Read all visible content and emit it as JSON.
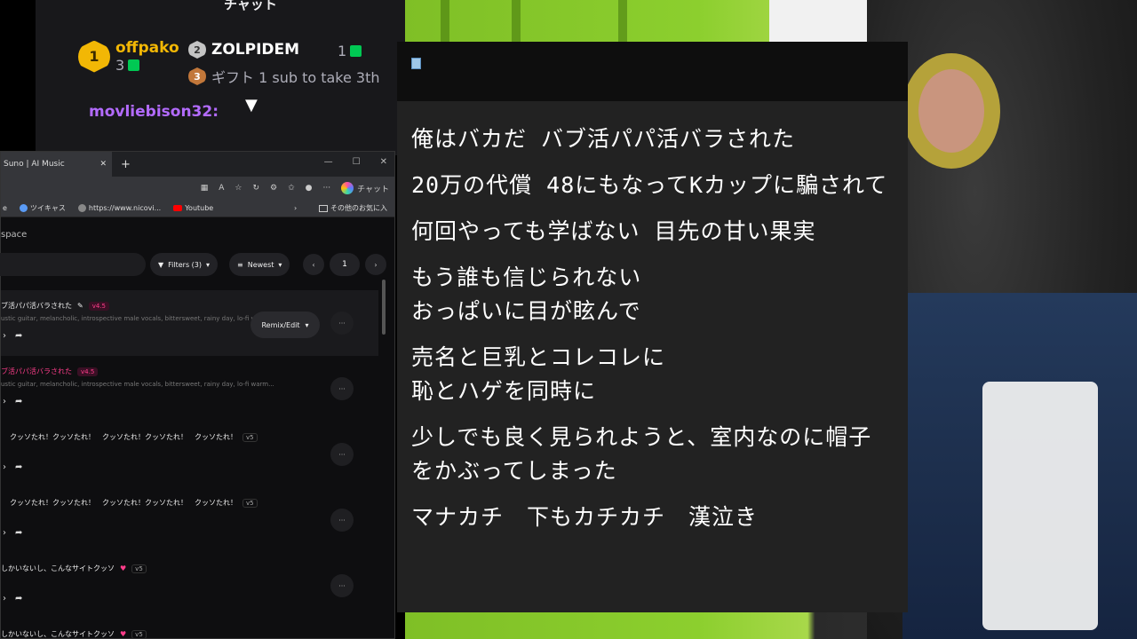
{
  "chat": {
    "header": "チャット",
    "first_name": "offpako",
    "first_rank": "1",
    "first_count": "3",
    "second_name": "ZOLPIDEM",
    "second_rank": "2",
    "second_count": "1",
    "third_rank": "3",
    "third_text": "ギフト 1 sub to take 3th",
    "message_user": "movliebison32:",
    "chevron": "▼"
  },
  "browser": {
    "tab_title": "Suno | AI Music",
    "tab_close": "✕",
    "new_tab": "+",
    "min": "—",
    "max": "☐",
    "close": "✕",
    "chat_label": "チャット",
    "bookmarks": [
      "ツイキャス",
      "https://www.nicovi...",
      "Youtube"
    ],
    "bookmark_first": "e",
    "bookmark_folder": "その他のお気に入",
    "chevron_right": "›"
  },
  "suno": {
    "workspace": "space",
    "filters_label": "Filters (3)",
    "sort_label": "Newest",
    "page": "1",
    "remix_label": "Remix/Edit",
    "more": "···",
    "songs": [
      {
        "title": "ブ活パパ活バラされた",
        "version": "v4.5",
        "tags": "ustic guitar, melancholic, introspective male vocals, bittersweet, rainy day, lo-fi warm..."
      },
      {
        "title": "ブ活パパ活バラされた",
        "version": "v4.5",
        "tags": "ustic guitar, melancholic, introspective male vocals, bittersweet, rainy day, lo-fi warm..."
      },
      {
        "title": "クッソたれ！クッソたれ！　クッソたれ！クッソたれ！　クッソたれ！",
        "version": "v5"
      },
      {
        "title": "クッソたれ！クッソたれ！　クッソたれ！クッソたれ！　クッソたれ！",
        "version": "v5"
      },
      {
        "title": "しかいないし、こんなサイトクッソ",
        "version": "v5"
      },
      {
        "title": "しかいないし、こんなサイトクッソ",
        "version": "v5"
      }
    ]
  },
  "lyrics": [
    "俺はバカだ バブ活パパ活バラされた",
    "20万の代償 48にもなってKカップに騙されて",
    "何回やっても学ばない 目先の甘い果実",
    "もう誰も信じられない\nおっぱいに目が眩んで",
    "売名と巨乳とコレコレに\n恥とハゲを同時に",
    "少しでも良く見られようと、室内なのに帽子をかぶってしまった",
    "マナカチ　下もカチカチ　漢泣き"
  ]
}
